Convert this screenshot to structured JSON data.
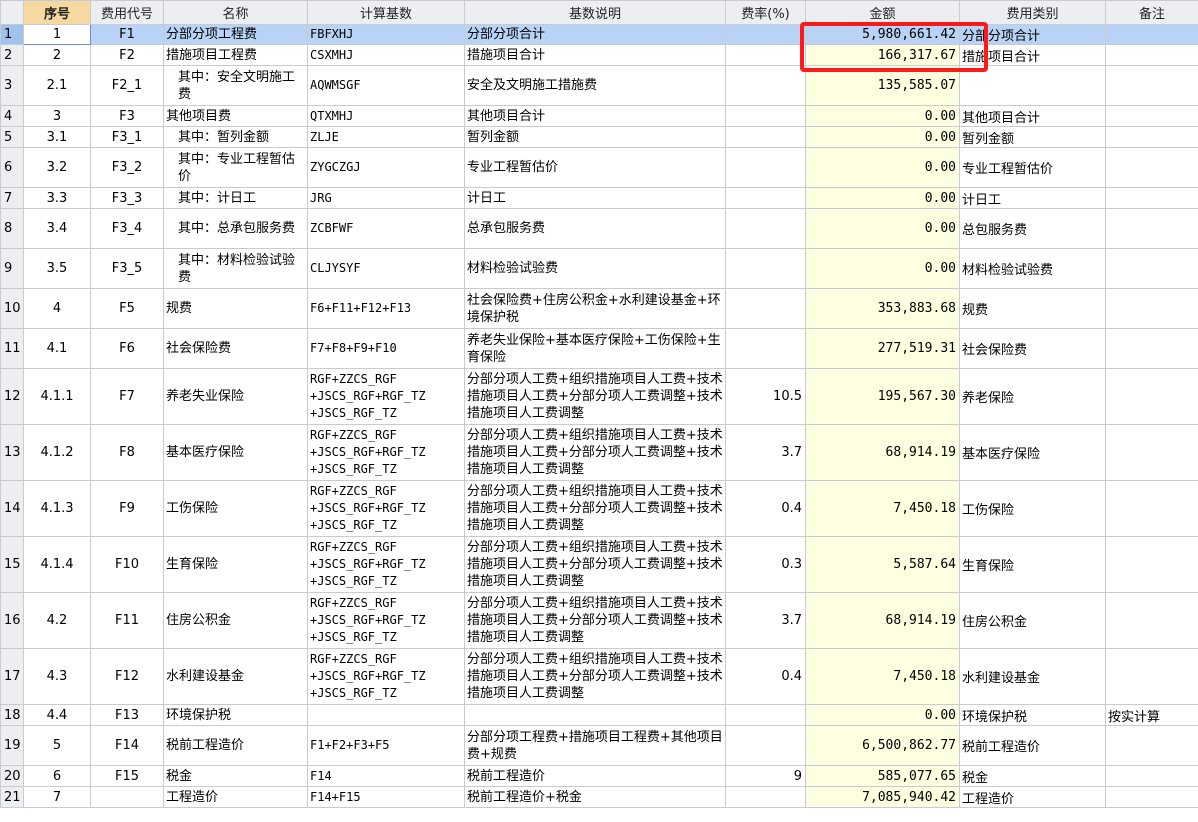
{
  "columns": {
    "row_num": "",
    "seq": "序号",
    "code": "费用代号",
    "name": "名称",
    "base": "计算基数",
    "base_desc": "基数说明",
    "rate": "费率(%)",
    "amount": "金额",
    "category": "费用类别",
    "note": "备注"
  },
  "colors": {
    "selected_row": "#b8d3f5",
    "amount_column": "#fefee0",
    "highlight_box": "#ff1a1a",
    "seq_header": "#f5d9a0"
  },
  "rows": [
    {
      "n": "1",
      "seq": "1",
      "code": "F1",
      "name": "分部分项工程费",
      "base": "FBFXHJ",
      "desc": "分部分项合计",
      "rate": "",
      "amount": "5,980,661.42",
      "cat": "分部分项合计",
      "note": ""
    },
    {
      "n": "2",
      "seq": "2",
      "code": "F2",
      "name": "措施项目工程费",
      "base": "CSXMHJ",
      "desc": "措施项目合计",
      "rate": "",
      "amount": "166,317.67",
      "cat": "措施项目合计",
      "note": ""
    },
    {
      "n": "3",
      "seq": "2.1",
      "code": "F2_1",
      "name": "其中：安全文明施工费",
      "base": "AQWMSGF",
      "desc": "安全及文明施工措施费",
      "rate": "",
      "amount": "135,585.07",
      "cat": "",
      "note": ""
    },
    {
      "n": "4",
      "seq": "3",
      "code": "F3",
      "name": "其他项目费",
      "base": "QTXMHJ",
      "desc": "其他项目合计",
      "rate": "",
      "amount": "0.00",
      "cat": "其他项目合计",
      "note": ""
    },
    {
      "n": "5",
      "seq": "3.1",
      "code": "F3_1",
      "name": "其中：暂列金额",
      "base": "ZLJE",
      "desc": "暂列金额",
      "rate": "",
      "amount": "0.00",
      "cat": "暂列金额",
      "note": ""
    },
    {
      "n": "6",
      "seq": "3.2",
      "code": "F3_2",
      "name": "其中：专业工程暂估价",
      "base": "ZYGCZGJ",
      "desc": "专业工程暂估价",
      "rate": "",
      "amount": "0.00",
      "cat": "专业工程暂估价",
      "note": ""
    },
    {
      "n": "7",
      "seq": "3.3",
      "code": "F3_3",
      "name": "其中：计日工",
      "base": "JRG",
      "desc": "计日工",
      "rate": "",
      "amount": "0.00",
      "cat": "计日工",
      "note": ""
    },
    {
      "n": "8",
      "seq": "3.4",
      "code": "F3_4",
      "name": "其中：总承包服务费",
      "base": "ZCBFWF",
      "desc": "总承包服务费",
      "rate": "",
      "amount": "0.00",
      "cat": "总包服务费",
      "note": ""
    },
    {
      "n": "9",
      "seq": "3.5",
      "code": "F3_5",
      "name": "其中：材料检验试验费",
      "base": "CLJYSYF",
      "desc": "材料检验试验费",
      "rate": "",
      "amount": "0.00",
      "cat": "材料检验试验费",
      "note": ""
    },
    {
      "n": "10",
      "seq": "4",
      "code": "F5",
      "name": "规费",
      "base": "F6+F11+F12+F13",
      "desc": "社会保险费+住房公积金+水利建设基金+环境保护税",
      "rate": "",
      "amount": "353,883.68",
      "cat": "规费",
      "note": ""
    },
    {
      "n": "11",
      "seq": "4.1",
      "code": "F6",
      "name": "社会保险费",
      "base": "F7+F8+F9+F10",
      "desc": "养老失业保险+基本医疗保险+工伤保险+生育保险",
      "rate": "",
      "amount": "277,519.31",
      "cat": "社会保险费",
      "note": ""
    },
    {
      "n": "12",
      "seq": "4.1.1",
      "code": "F7",
      "name": "养老失业保险",
      "base": "RGF+ZZCS_RGF +JSCS_RGF+RGF_TZ +JSCS_RGF_TZ",
      "desc": "分部分项人工费+组织措施项目人工费+技术措施项目人工费+分部分项人工费调整+技术措施项目人工费调整",
      "rate": "10.5",
      "amount": "195,567.30",
      "cat": "养老保险",
      "note": ""
    },
    {
      "n": "13",
      "seq": "4.1.2",
      "code": "F8",
      "name": "基本医疗保险",
      "base": "RGF+ZZCS_RGF +JSCS_RGF+RGF_TZ +JSCS_RGF_TZ",
      "desc": "分部分项人工费+组织措施项目人工费+技术措施项目人工费+分部分项人工费调整+技术措施项目人工费调整",
      "rate": "3.7",
      "amount": "68,914.19",
      "cat": "基本医疗保险",
      "note": ""
    },
    {
      "n": "14",
      "seq": "4.1.3",
      "code": "F9",
      "name": "工伤保险",
      "base": "RGF+ZZCS_RGF +JSCS_RGF+RGF_TZ +JSCS_RGF_TZ",
      "desc": "分部分项人工费+组织措施项目人工费+技术措施项目人工费+分部分项人工费调整+技术措施项目人工费调整",
      "rate": "0.4",
      "amount": "7,450.18",
      "cat": "工伤保险",
      "note": ""
    },
    {
      "n": "15",
      "seq": "4.1.4",
      "code": "F10",
      "name": "生育保险",
      "base": "RGF+ZZCS_RGF +JSCS_RGF+RGF_TZ +JSCS_RGF_TZ",
      "desc": "分部分项人工费+组织措施项目人工费+技术措施项目人工费+分部分项人工费调整+技术措施项目人工费调整",
      "rate": "0.3",
      "amount": "5,587.64",
      "cat": "生育保险",
      "note": ""
    },
    {
      "n": "16",
      "seq": "4.2",
      "code": "F11",
      "name": "住房公积金",
      "base": "RGF+ZZCS_RGF +JSCS_RGF+RGF_TZ +JSCS_RGF_TZ",
      "desc": "分部分项人工费+组织措施项目人工费+技术措施项目人工费+分部分项人工费调整+技术措施项目人工费调整",
      "rate": "3.7",
      "amount": "68,914.19",
      "cat": "住房公积金",
      "note": ""
    },
    {
      "n": "17",
      "seq": "4.3",
      "code": "F12",
      "name": "水利建设基金",
      "base": "RGF+ZZCS_RGF +JSCS_RGF+RGF_TZ +JSCS_RGF_TZ",
      "desc": "分部分项人工费+组织措施项目人工费+技术措施项目人工费+分部分项人工费调整+技术措施项目人工费调整",
      "rate": "0.4",
      "amount": "7,450.18",
      "cat": "水利建设基金",
      "note": ""
    },
    {
      "n": "18",
      "seq": "4.4",
      "code": "F13",
      "name": "环境保护税",
      "base": "",
      "desc": "",
      "rate": "",
      "amount": "0.00",
      "cat": "环境保护税",
      "note": "按实计算"
    },
    {
      "n": "19",
      "seq": "5",
      "code": "F14",
      "name": "税前工程造价",
      "base": "F1+F2+F3+F5",
      "desc": "分部分项工程费+措施项目工程费+其他项目费+规费",
      "rate": "",
      "amount": "6,500,862.77",
      "cat": "税前工程造价",
      "note": ""
    },
    {
      "n": "20",
      "seq": "6",
      "code": "F15",
      "name": "税金",
      "base": "F14",
      "desc": "税前工程造价",
      "rate": "9",
      "amount": "585,077.65",
      "cat": "税金",
      "note": ""
    },
    {
      "n": "21",
      "seq": "7",
      "code": "",
      "name": "工程造价",
      "base": "F14+F15",
      "desc": "税前工程造价+税金",
      "rate": "",
      "amount": "7,085,940.42",
      "cat": "工程造价",
      "note": ""
    }
  ]
}
